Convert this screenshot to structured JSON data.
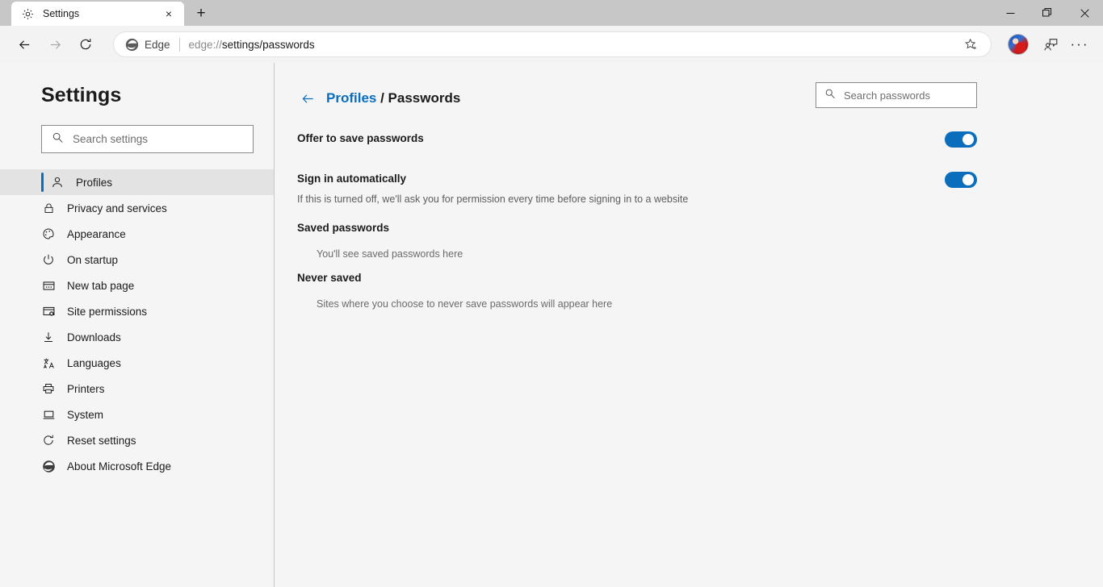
{
  "window": {
    "minimize_label": "Minimize",
    "restore_label": "Restore",
    "close_label": "Close"
  },
  "tabstrip": {
    "tabs": [
      {
        "title": "Settings",
        "favicon": "gear-icon",
        "close_label": "×"
      }
    ],
    "new_tab_label": "+"
  },
  "toolbar": {
    "back_label": "Back",
    "forward_label": "Forward",
    "refresh_label": "Refresh",
    "omnibox": {
      "brand_label": "Edge",
      "url_scheme": "edge://",
      "url_path": "settings/passwords",
      "favorites_label": "Add this page to favorites"
    },
    "profile_label": "Profile",
    "collections_label": "Collections",
    "more_label": "···"
  },
  "sidebar": {
    "title": "Settings",
    "search": {
      "placeholder": "Search settings",
      "value": "",
      "icon": "search-icon"
    },
    "items": [
      {
        "label": "Profiles",
        "icon": "person-icon",
        "selected": true
      },
      {
        "label": "Privacy and services",
        "icon": "lock-icon",
        "selected": false
      },
      {
        "label": "Appearance",
        "icon": "palette-icon",
        "selected": false
      },
      {
        "label": "On startup",
        "icon": "power-icon",
        "selected": false
      },
      {
        "label": "New tab page",
        "icon": "newtab-icon",
        "selected": false
      },
      {
        "label": "Site permissions",
        "icon": "permissions-icon",
        "selected": false
      },
      {
        "label": "Downloads",
        "icon": "download-icon",
        "selected": false
      },
      {
        "label": "Languages",
        "icon": "languages-icon",
        "selected": false
      },
      {
        "label": "Printers",
        "icon": "printer-icon",
        "selected": false
      },
      {
        "label": "System",
        "icon": "laptop-icon",
        "selected": false
      },
      {
        "label": "Reset settings",
        "icon": "reset-icon",
        "selected": false
      },
      {
        "label": "About Microsoft Edge",
        "icon": "edge-logo-icon",
        "selected": false
      }
    ]
  },
  "main": {
    "back_label": "Back to Profiles",
    "breadcrumb": {
      "parent": "Profiles",
      "separator": " / ",
      "current": "Passwords"
    },
    "search_passwords": {
      "placeholder": "Search passwords",
      "value": "",
      "icon": "search-icon"
    },
    "settings": [
      {
        "label": "Offer to save passwords",
        "description": "",
        "toggle_on": true
      },
      {
        "label": "Sign in automatically",
        "description": "If this is turned off, we'll ask you for permission every time before signing in to a website",
        "toggle_on": true
      }
    ],
    "saved_passwords": {
      "heading": "Saved passwords",
      "empty_text": "You'll see saved passwords here"
    },
    "never_saved": {
      "heading": "Never saved",
      "empty_text": "Sites where you choose to never save passwords will appear here"
    }
  },
  "colors": {
    "accent": "#0a6ebd",
    "titlebar": "#c7c7c7",
    "toolbar": "#f3f3f3",
    "page_bg": "#f5f5f5",
    "selected_row": "#e3e3e3"
  }
}
